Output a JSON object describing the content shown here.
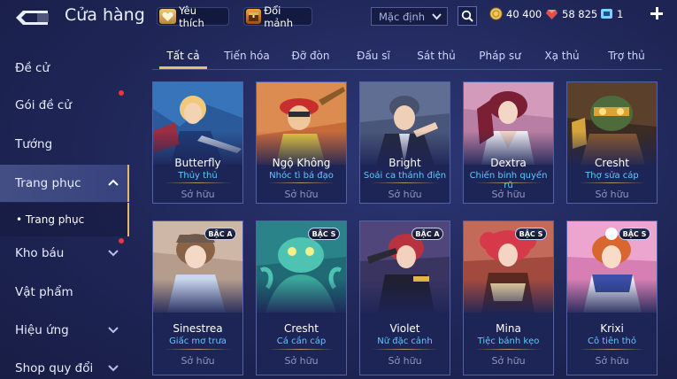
{
  "header": {
    "title": "Cửa hàng",
    "favorites_label": "Yêu thích",
    "fragments_label": "Đổi mảnh",
    "sort_value": "Mặc định",
    "gold": "40 400",
    "rubies": "58 825",
    "tickets": "1"
  },
  "sidebar": {
    "items": [
      {
        "label": "Đề cử"
      },
      {
        "label": "Gói đề cử"
      },
      {
        "label": "Tướng"
      },
      {
        "label": "Trang phục"
      },
      {
        "label": "Kho báu"
      },
      {
        "label": "Vật phẩm"
      },
      {
        "label": "Hiệu ứng"
      },
      {
        "label": "Shop quy đổi"
      }
    ],
    "sub_item": "• Trang phục"
  },
  "tabs": [
    "Tất cả",
    "Tiến hóa",
    "Đỡ đòn",
    "Đấu sĩ",
    "Sát thủ",
    "Pháp sư",
    "Xạ thủ",
    "Trợ thủ"
  ],
  "cards": [
    {
      "hero": "Butterfly",
      "skin": "Thủy thủ",
      "status": "Sở hữu",
      "badge": ""
    },
    {
      "hero": "Ngộ Không",
      "skin": "Nhóc tì bá đạo",
      "status": "Sở hữu",
      "badge": ""
    },
    {
      "hero": "Bright",
      "skin": "Soái ca thánh điện",
      "status": "Sở hữu",
      "badge": ""
    },
    {
      "hero": "Dextra",
      "skin": "Chiến binh quyến rũ",
      "status": "Sở hữu",
      "badge": ""
    },
    {
      "hero": "Cresht",
      "skin": "Thợ sửa cáp",
      "status": "Sở hữu",
      "badge": ""
    },
    {
      "hero": "Sinestrea",
      "skin": "Giấc mơ trưa",
      "status": "Sở hữu",
      "badge": "BẬC A"
    },
    {
      "hero": "Cresht",
      "skin": "Cá cần cáp",
      "status": "Sở hữu",
      "badge": "BẬC S"
    },
    {
      "hero": "Violet",
      "skin": "Nữ đặc cảnh",
      "status": "Sở hữu",
      "badge": "BẬC A"
    },
    {
      "hero": "Mina",
      "skin": "Tiệc bánh kẹo",
      "status": "Sở hữu",
      "badge": "BẬC S"
    },
    {
      "hero": "Krixi",
      "skin": "Cô tiên thỏ",
      "status": "Sở hữu",
      "badge": "BẬC S"
    }
  ],
  "colors": {
    "accent_gold": "#e5bf72",
    "skin_name_blue": "#63c6ff",
    "notification_red": "#e8373a"
  }
}
